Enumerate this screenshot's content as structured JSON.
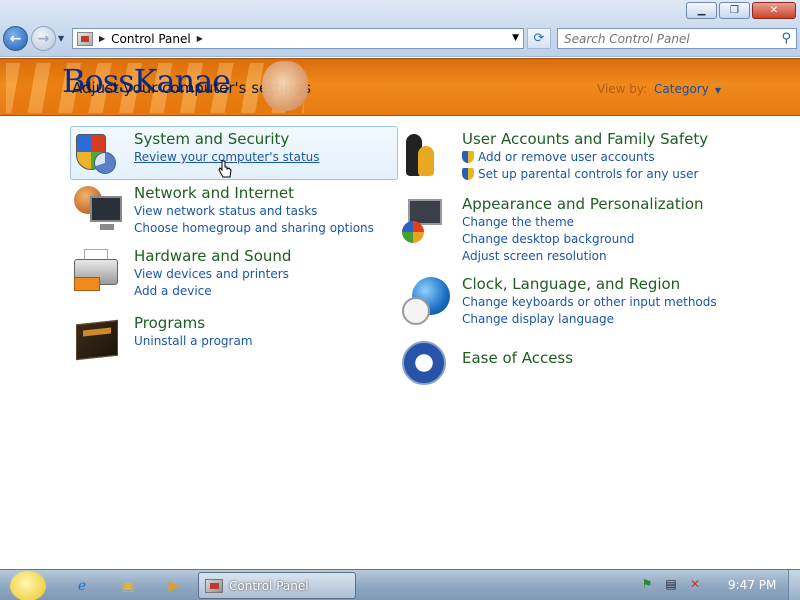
{
  "window": {
    "minimize_icon": "minimize-icon",
    "maximize_icon": "restore-icon",
    "close_icon": "close-icon"
  },
  "nav": {
    "address_crumb": "Control Panel",
    "search_placeholder": "Search Control Panel"
  },
  "banner": {
    "brand_text": "BossKanae",
    "heading": "Adjust your computer's settings",
    "view_by_label": "View by:",
    "view_by_value": "Category"
  },
  "categories": {
    "system_security": {
      "title": "System and Security",
      "links": [
        "Review your computer's status"
      ]
    },
    "network": {
      "title": "Network and Internet",
      "links": [
        "View network status and tasks",
        "Choose homegroup and sharing options"
      ]
    },
    "hardware": {
      "title": "Hardware and Sound",
      "links": [
        "View devices and printers",
        "Add a device"
      ]
    },
    "programs": {
      "title": "Programs",
      "links": [
        "Uninstall a program"
      ]
    },
    "user_accounts": {
      "title": "User Accounts and Family Safety",
      "links": [
        "Add or remove user accounts",
        "Set up parental controls for any user"
      ]
    },
    "appearance": {
      "title": "Appearance and Personalization",
      "links": [
        "Change the theme",
        "Change desktop background",
        "Adjust screen resolution"
      ]
    },
    "clock_region": {
      "title": "Clock, Language, and Region",
      "links": [
        "Change keyboards or other input methods",
        "Change display language"
      ]
    },
    "ease": {
      "title": "Ease of Access",
      "links": []
    }
  },
  "taskbar": {
    "task_label": "Control Panel",
    "clock": "9:47 PM"
  },
  "colors": {
    "category_title": "#1d5e1f",
    "link": "#1a56a8",
    "banner_orange": "#ef8a1c"
  }
}
